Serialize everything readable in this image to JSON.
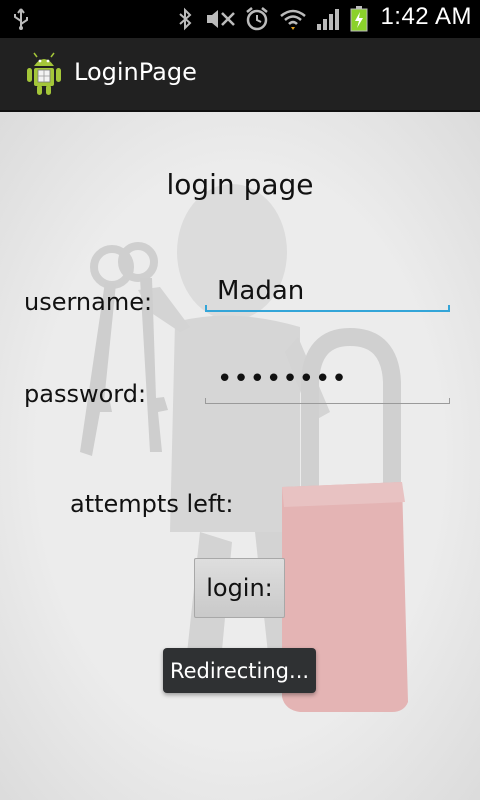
{
  "status_bar": {
    "time": "1:42 AM",
    "icons": [
      "usb-icon",
      "bluetooth-icon",
      "mute-icon",
      "alarm-icon",
      "wifi-icon",
      "signal-icon",
      "battery-charging-icon"
    ]
  },
  "action_bar": {
    "title": "LoginPage",
    "icon": "android-app-icon"
  },
  "form": {
    "title": "login page",
    "username_label": "username:",
    "username_value": "Madan",
    "password_label": "password:",
    "password_value": "••••••••",
    "attempts_label": "attempts left:",
    "login_button": "login:"
  },
  "toast": {
    "message": "Redirecting..."
  },
  "colors": {
    "focus_underline": "#33a5d8",
    "action_bar": "#212121",
    "toast_bg": "#2f3133"
  }
}
